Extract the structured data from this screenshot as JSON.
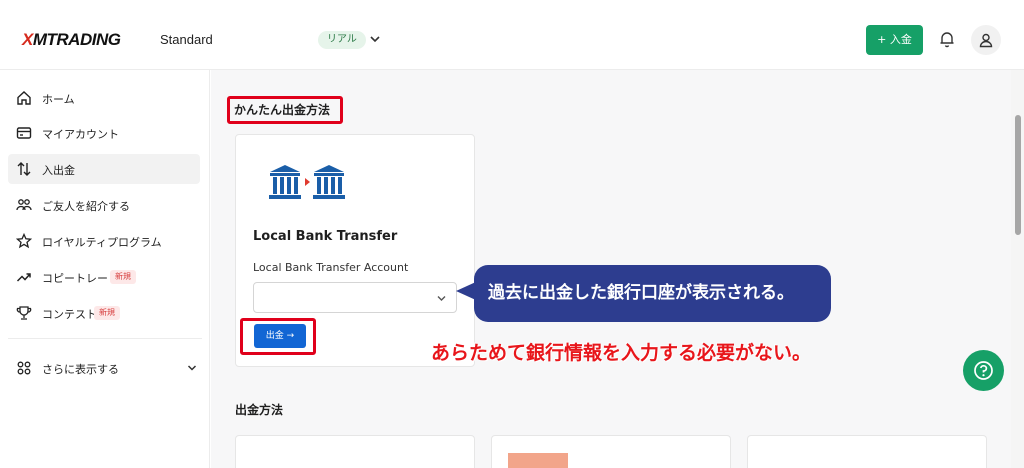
{
  "header": {
    "logo_x": "X",
    "logo_rest": "MTRADING",
    "account_type": "Standard",
    "account_badge": "リアル",
    "deposit_button": "+ 入金"
  },
  "sidebar": {
    "items": [
      {
        "label": "ホーム",
        "icon": "home-icon"
      },
      {
        "label": "マイアカウント",
        "icon": "wallet-icon"
      },
      {
        "label": "入出金",
        "icon": "transfer-arrows-icon",
        "active": true
      },
      {
        "label": "ご友人を紹介する",
        "icon": "people-icon"
      },
      {
        "label": "ロイヤルティプログラム",
        "icon": "star-icon"
      },
      {
        "label": "コピートレード",
        "icon": "trend-up-icon",
        "tag": "新規"
      },
      {
        "label": "コンテスト",
        "icon": "trophy-icon",
        "tag": "新規"
      }
    ],
    "more_label": "さらに表示する"
  },
  "main": {
    "easy_withdrawal_title": "かんたん出金方法",
    "card": {
      "title": "Local Bank Transfer",
      "field_label": "Local Bank Transfer Account",
      "select_value": "",
      "withdraw_button": "出金 →"
    },
    "methods_title": "出金方法"
  },
  "annotations": {
    "callout_text": "過去に出金した銀行口座が表示される。",
    "red_note": "あらためて銀行情報を入力する必要がない。"
  },
  "colors": {
    "brand_green": "#16a067",
    "accent_blue": "#1266d4",
    "highlight_red": "#e0001b",
    "callout_navy": "#2d3d8f",
    "logo_red": "#d62b1e"
  }
}
